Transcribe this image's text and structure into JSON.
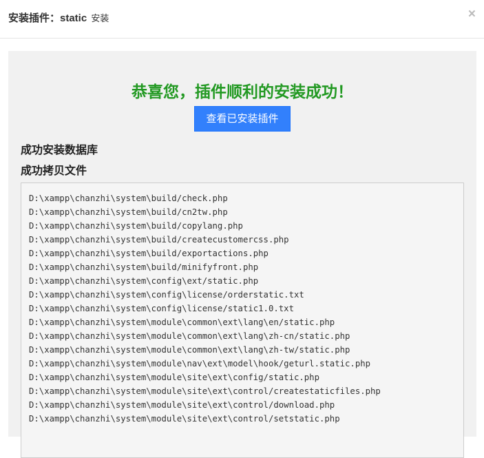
{
  "header": {
    "title": "安装插件：static",
    "subtitle": "安装",
    "close": "×"
  },
  "main": {
    "success_message": "恭喜您，插件顺利的安装成功！",
    "view_button": "查看已安装插件",
    "db_heading": "成功安装数据库",
    "files_heading": "成功拷贝文件",
    "files": [
      "D:\\xampp\\chanzhi\\system\\build/check.php",
      "D:\\xampp\\chanzhi\\system\\build/cn2tw.php",
      "D:\\xampp\\chanzhi\\system\\build/copylang.php",
      "D:\\xampp\\chanzhi\\system\\build/createcustomercss.php",
      "D:\\xampp\\chanzhi\\system\\build/exportactions.php",
      "D:\\xampp\\chanzhi\\system\\build/minifyfront.php",
      "D:\\xampp\\chanzhi\\system\\config\\ext/static.php",
      "D:\\xampp\\chanzhi\\system\\config\\license/orderstatic.txt",
      "D:\\xampp\\chanzhi\\system\\config\\license/static1.0.txt",
      "D:\\xampp\\chanzhi\\system\\module\\common\\ext\\lang\\en/static.php",
      "D:\\xampp\\chanzhi\\system\\module\\common\\ext\\lang\\zh-cn/static.php",
      "D:\\xampp\\chanzhi\\system\\module\\common\\ext\\lang\\zh-tw/static.php",
      "D:\\xampp\\chanzhi\\system\\module\\nav\\ext\\model\\hook/geturl.static.php",
      "D:\\xampp\\chanzhi\\system\\module\\site\\ext\\config/static.php",
      "D:\\xampp\\chanzhi\\system\\module\\site\\ext\\control/createstaticfiles.php",
      "D:\\xampp\\chanzhi\\system\\module\\site\\ext\\control/download.php",
      "D:\\xampp\\chanzhi\\system\\module\\site\\ext\\control/setstatic.php"
    ]
  }
}
